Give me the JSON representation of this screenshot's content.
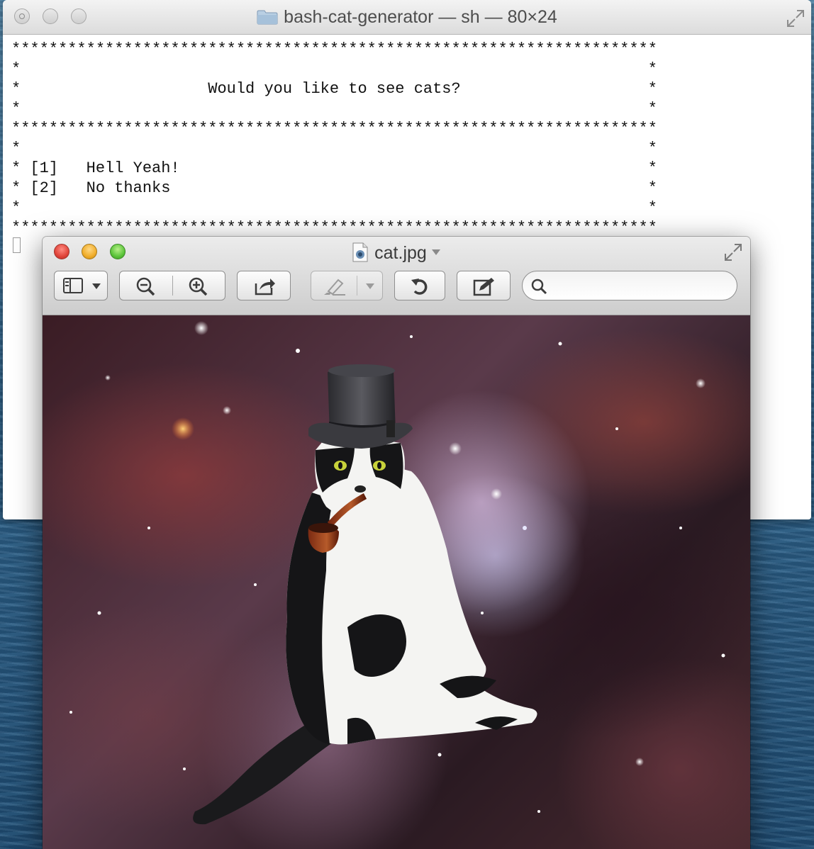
{
  "terminal": {
    "title": "bash-cat-generator — sh — 80×24",
    "lines": [
      "*********************************************************************",
      "*                                                                   *",
      "*                    Would you like to see cats?                    *",
      "*                                                                   *",
      "*********************************************************************",
      "*                                                                   *",
      "* [1]   Hell Yeah!                                                  *",
      "* [2]   No thanks                                                   *",
      "*                                                                   *",
      "*********************************************************************"
    ]
  },
  "preview": {
    "title": "cat.jpg",
    "search": {
      "value": "",
      "placeholder": ""
    },
    "toolbar": {
      "icons": [
        "sidebar-icon",
        "zoom-out-icon",
        "zoom-in-icon",
        "share-icon",
        "highlight-icon",
        "rotate-icon",
        "edit-icon",
        "search-icon"
      ]
    },
    "image": {
      "subject": "cat-in-top-hat-with-pipe-space-background"
    }
  },
  "colors": {
    "close": "#e0443a",
    "minimize": "#f0ad2b",
    "maximize": "#5bc43a",
    "terminal_bg": "#ffffff",
    "desktop": "#32658c"
  }
}
